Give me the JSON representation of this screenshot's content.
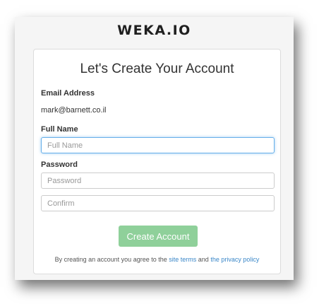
{
  "brand": {
    "logo_text": "WEKA.IO"
  },
  "form": {
    "title": "Let's Create Your Account",
    "email_label": "Email Address",
    "email_value": "mark@barnett.co.il",
    "fullname_label": "Full Name",
    "fullname_placeholder": "Full Name",
    "password_label": "Password",
    "password_placeholder": "Password",
    "confirm_placeholder": "Confirm",
    "submit_label": "Create Account",
    "submit_color": "#8fd09a"
  },
  "terms": {
    "prefix": "By creating an account you agree to the",
    "site_terms": "site terms",
    "conjunction": "and",
    "privacy_policy": "the privacy policy"
  },
  "colors": {
    "link": "#3a87c8",
    "focus": "#66afe9"
  }
}
